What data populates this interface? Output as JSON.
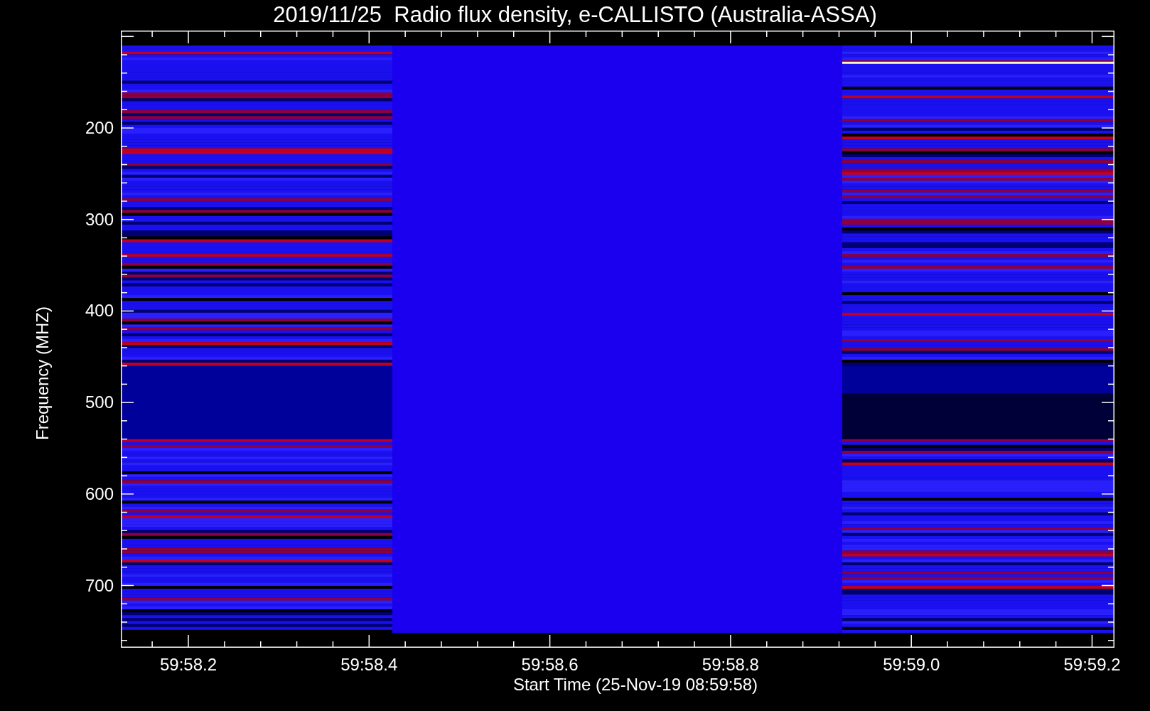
{
  "title": "2019/11/25  Radio flux density, e-CALLISTO (Australia-ASSA)",
  "y_axis": {
    "label": "Frequency (MHZ)",
    "ticks": [
      "200",
      "300",
      "400",
      "500",
      "600",
      "700"
    ]
  },
  "x_axis": {
    "label": "Start Time (25-Nov-19 08:59:58)",
    "ticks": [
      "59:58.2",
      "59:58.4",
      "59:58.6",
      "59:58.8",
      "59:59.0",
      "59:59.2"
    ]
  }
}
